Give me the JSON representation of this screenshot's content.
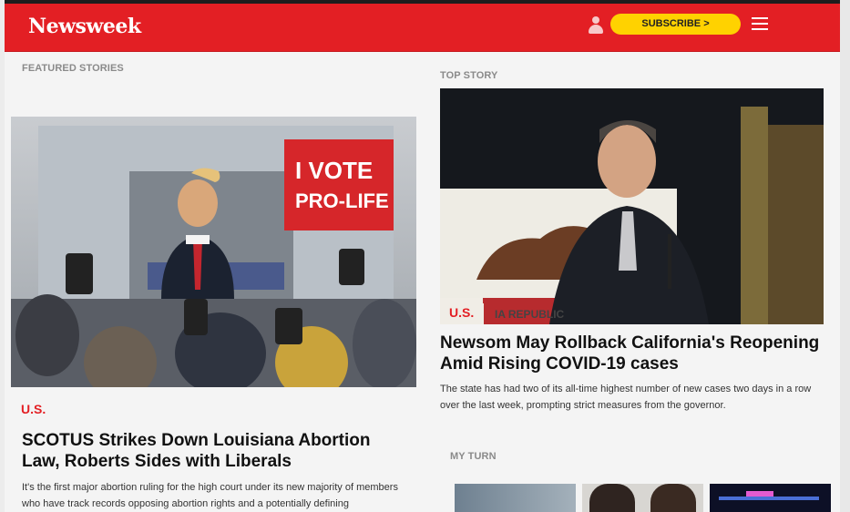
{
  "header": {
    "logo": "Newsweek",
    "subscribe_label": "SUBSCRIBE >",
    "account_icon": "user-icon",
    "menu_icon": "hamburger-menu-icon",
    "brand_color": "#e31f24",
    "subscribe_color": "#ffd200"
  },
  "featured": {
    "section_label": "FEATURED STORIES",
    "category": "U.S.",
    "headline": "SCOTUS Strikes Down Louisiana Abortion Law, Roberts Sides with Liberals",
    "summary": "It's the first major abortion ruling for the high court under its new majority of members who have track records opposing abortion rights and a potentially defining",
    "image_sign_text": "I VOTE PRO-LIFE"
  },
  "top_story": {
    "section_label": "TOP STORY",
    "category": "U.S.",
    "headline": "Newsom May Rollback California's Reopening Amid Rising COVID-19 cases",
    "summary": "The state has had two of its all-time highest number of new cases two days in a row over the last week, prompting strict measures from the governor.",
    "image_banner_text": "IA REPUBLIC"
  },
  "my_turn": {
    "section_label": "MY TURN"
  }
}
